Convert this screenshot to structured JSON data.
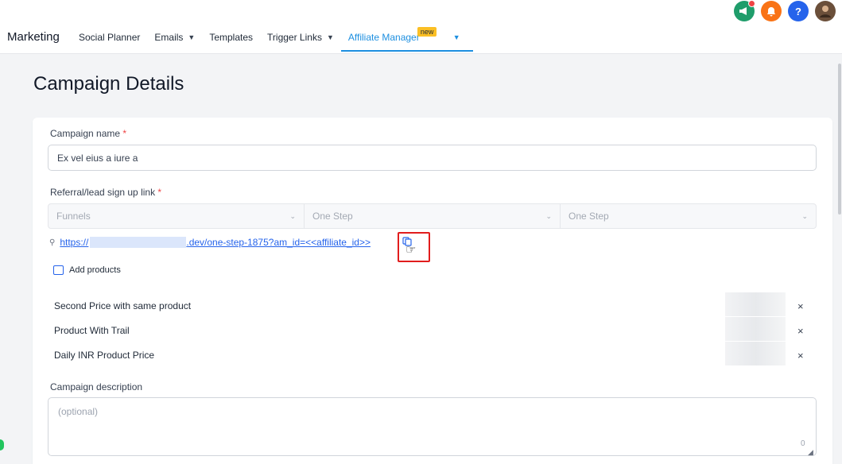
{
  "header": {
    "brand": "Marketing",
    "nav": [
      {
        "label": "Social Planner",
        "has_dropdown": false
      },
      {
        "label": "Emails",
        "has_dropdown": true
      },
      {
        "label": "Templates",
        "has_dropdown": false
      },
      {
        "label": "Trigger Links",
        "has_dropdown": true
      },
      {
        "label": "Affiliate Manager",
        "has_dropdown": true,
        "active": true,
        "badge": "new"
      }
    ],
    "icons": [
      "megaphone-icon",
      "bell-icon",
      "help-icon",
      "avatar"
    ],
    "help_glyph": "?",
    "accent_color": "#1d8fe0"
  },
  "page": {
    "title": "Campaign Details"
  },
  "form": {
    "campaign_name": {
      "label": "Campaign name",
      "required_mark": "*",
      "value": "Ex vel eius a iure a"
    },
    "signup_link": {
      "label": "Referral/lead sign up link",
      "required_mark": "*",
      "selects": [
        "Funnels",
        "One Step",
        "One Step"
      ],
      "url_prefix": "https://",
      "url_suffix": ".dev/one-step-1875?am_id=<<affiliate_id>>"
    },
    "add_products_label": "Add products",
    "products": [
      {
        "name": "Second Price with same product",
        "remove_glyph": "×"
      },
      {
        "name": "Product With Trail",
        "remove_glyph": "×"
      },
      {
        "name": "Daily INR Product Price",
        "remove_glyph": "×"
      }
    ],
    "description": {
      "label": "Campaign description",
      "placeholder": "(optional)",
      "char_count": "0"
    }
  }
}
